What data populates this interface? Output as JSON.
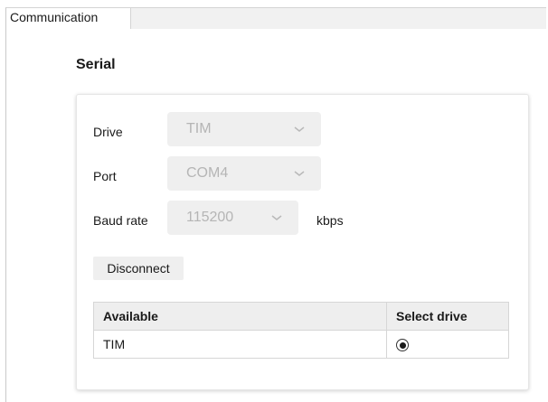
{
  "tabs": [
    {
      "label": "Communication"
    }
  ],
  "section": {
    "title": "Serial"
  },
  "fields": {
    "drive": {
      "label": "Drive",
      "value": "TIM"
    },
    "port": {
      "label": "Port",
      "value": "COM4"
    },
    "baud": {
      "label": "Baud rate",
      "value": "115200",
      "unit": "kbps"
    }
  },
  "buttons": {
    "disconnect": "Disconnect"
  },
  "table": {
    "headers": [
      "Available",
      "Select drive"
    ],
    "rows": [
      {
        "name": "TIM",
        "selected": true
      }
    ]
  },
  "colors": {
    "accent": "#1a1a1a",
    "field_bg": "#efefef",
    "field_text_disabled": "#b5b5b5"
  }
}
